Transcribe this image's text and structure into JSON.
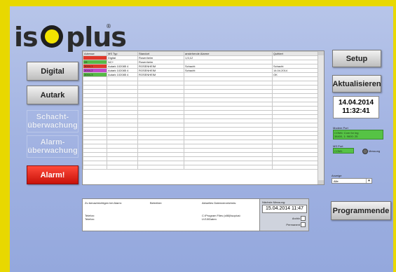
{
  "logo": {
    "part1": "is",
    "part2": "plus",
    "mark": "®"
  },
  "nav": {
    "digital": "Digital",
    "autark": "Autark",
    "schacht_line1": "Schacht-",
    "schacht_line2": "überwachung",
    "alarm_line1": "Alarm-",
    "alarm_line2": "überwachung",
    "alarm_button": "Alarm!"
  },
  "table": {
    "headers": [
      "Adresse",
      "MS Typ",
      "Standort",
      "anstehende Alarme",
      "Quittiert"
    ],
    "rows": [
      {
        "address_color": "#e0382a",
        "cells": [
          "",
          "Digital",
          "Rosenheim",
          "1,5,12",
          ""
        ]
      },
      {
        "address_color": "#56b947",
        "cells": [
          "28",
          "NC+",
          "Rosenheim",
          "",
          ""
        ]
      },
      {
        "address_color": "#e0382a",
        "cells": [
          "3004-1",
          "Autark 102085 4",
          "ROSENHEIM",
          "Schacht",
          "Schacht"
        ]
      },
      {
        "address_color": "#c24acb",
        "cells": [
          "3004-2",
          "Autark 102085 4",
          "ROSENHEIM",
          "Schacht",
          "14.04.2014"
        ]
      },
      {
        "address_color": "#56b947",
        "cells": [
          "3004-3",
          "Autark 102085 4",
          "ROSENHEIM",
          "",
          "OK"
        ]
      }
    ],
    "empty_rows": 22
  },
  "right": {
    "setup": "Setup",
    "refresh": "Aktualisieren",
    "date": "14.04.2014",
    "time": "11:32:41",
    "modem_port_label": "Modem Port",
    "modem_port_line1": "COM4: Com for ing",
    "modem_port_line2": "38400, 1: 9600: 25",
    "ms_port_label": "MS Port",
    "ms_port_value": "COM1",
    "measurement_label": "Messung",
    "display_label": "Anzeige",
    "display_value": "Alle"
  },
  "info": {
    "notify_label": "Zu benachrichtigen bei Alarm:",
    "operator_label": "Betreiber:",
    "dir_label": "Aktuelles Datenverzeichnis:",
    "phone1": "Telefon:",
    "phone2": "Telefon:",
    "dir_line1": "C:\\Program Files (x86)\\isoplus\\",
    "dir_line2": "LV10\\Daten"
  },
  "measurement": {
    "label": "Nächste Messung:",
    "value": "15.04.2014 11:47",
    "archive_label": "Archiv",
    "permanent_label": "Permanent"
  },
  "programmende": "Programmende"
}
